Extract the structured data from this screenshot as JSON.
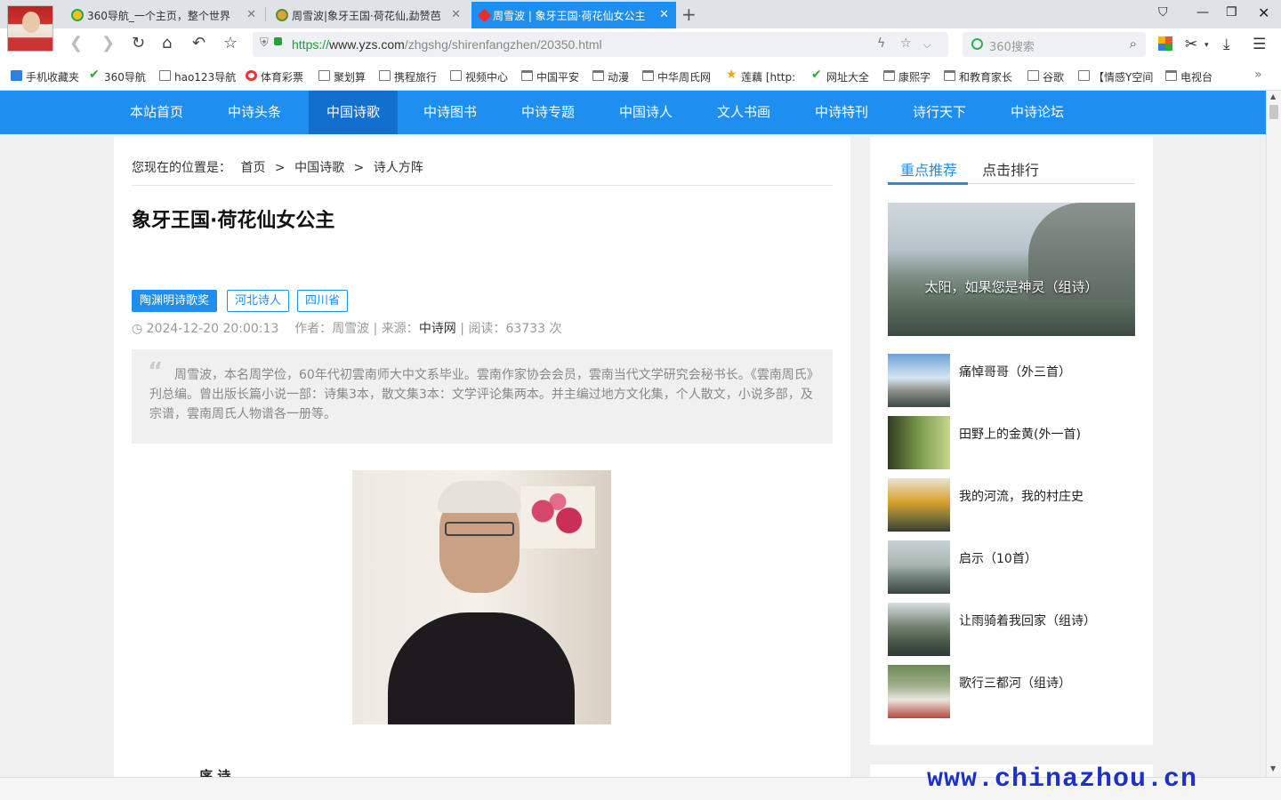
{
  "browser": {
    "tabs": [
      {
        "label": "360导航_一个主页，整个世界",
        "icon": "360-nav-icon"
      },
      {
        "label": "周雪波|象牙王国·荷花仙,勐赞芭",
        "icon": "yzs-site-icon"
      },
      {
        "label": "周雪波 | 象牙王国·荷花仙女公主",
        "icon": "yzs-site-icon"
      }
    ],
    "active_tab": 2,
    "url": {
      "scheme": "https://",
      "host": "www.yzs.com",
      "path": "/zhgshg/shirenfangzhen/20350.html"
    },
    "search_placeholder": "360搜索",
    "bookmarks": [
      {
        "label": "手机收藏夹",
        "icon": "phone-icon"
      },
      {
        "label": "360导航",
        "icon": "hao-icon"
      },
      {
        "label": "hao123导航",
        "icon": "page-icon"
      },
      {
        "label": "体育彩票",
        "icon": "lottery-icon"
      },
      {
        "label": "聚划算",
        "icon": "page-icon"
      },
      {
        "label": "携程旅行",
        "icon": "page-icon"
      },
      {
        "label": "视频中心",
        "icon": "page-icon"
      },
      {
        "label": "中国平安",
        "icon": "folder-icon"
      },
      {
        "label": "动漫",
        "icon": "folder-icon"
      },
      {
        "label": "中华周氏网",
        "icon": "folder-icon"
      },
      {
        "label": "莲藕 [http:",
        "icon": "star-icon"
      },
      {
        "label": "网址大全",
        "icon": "hao-icon"
      },
      {
        "label": "康熙字",
        "icon": "folder-icon"
      },
      {
        "label": "和教育家长",
        "icon": "folder-icon"
      },
      {
        "label": "谷歌",
        "icon": "page-icon"
      },
      {
        "label": "【情感Y空间",
        "icon": "page-icon"
      },
      {
        "label": "电视台",
        "icon": "folder-icon"
      }
    ]
  },
  "site": {
    "nav": [
      "本站首页",
      "中诗头条",
      "中国诗歌",
      "中诗图书",
      "中诗专题",
      "中国诗人",
      "文人书画",
      "中诗特刊",
      "诗行天下",
      "中诗论坛"
    ],
    "nav_active": 2,
    "accent_color": "#1e8ef0"
  },
  "article": {
    "breadcrumb": {
      "prefix": "您现在的位置是：",
      "items": [
        "首页",
        ">",
        "中国诗歌",
        ">",
        "诗人方阵"
      ]
    },
    "title": "象牙王国·荷花仙女公主",
    "tags": [
      "陶渊明诗歌奖",
      "河北诗人",
      "四川省"
    ],
    "meta": {
      "datetime": "2024-12-20 20:00:13",
      "author_label": "作者：",
      "author": "周雪波",
      "source_label": "来源：",
      "source": "中诗网",
      "reads_label": "阅读：",
      "reads": "63733",
      "reads_unit": "次"
    },
    "summary": "周雪波，本名周学俭，60年代初雲南师大中文系毕业。雲南作家协会会员，雲南当代文学研究会秘书长。《雲南周氏》刋总编。曾出版长篇小说一部：诗集3本，散文集3本：文学评论集两本。并主编过地方文化集，个人散文，小说多部，及宗谱，雲南周氏人物谱各一册等。",
    "section_heading": "序 诗"
  },
  "sidebar": {
    "tabs": [
      "重点推荐",
      "点击排行"
    ],
    "active_tab": 0,
    "feature": {
      "caption": "太阳，如果您是神灵（组诗）"
    },
    "items": [
      {
        "title": "痛悼哥哥（外三首）"
      },
      {
        "title": "田野上的金黄(外一首)"
      },
      {
        "title": "我的河流，我的村庄史"
      },
      {
        "title": "启示（10首）"
      },
      {
        "title": "让雨骑着我回家（组诗）"
      },
      {
        "title": "歌行三都河（组诗）"
      }
    ]
  },
  "watermark": "www.chinazhou.cn"
}
